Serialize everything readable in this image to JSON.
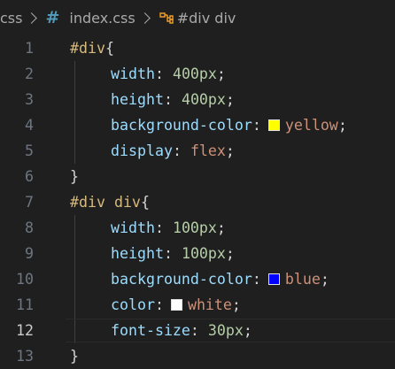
{
  "breadcrumb": {
    "folder": "css",
    "file_icon": "#",
    "file": "index.css",
    "symbol_icon": "symbol-class-icon",
    "symbol": "#div div"
  },
  "lines": [
    {
      "n": "1"
    },
    {
      "n": "2"
    },
    {
      "n": "3"
    },
    {
      "n": "4"
    },
    {
      "n": "5"
    },
    {
      "n": "6"
    },
    {
      "n": "7"
    },
    {
      "n": "8"
    },
    {
      "n": "9"
    },
    {
      "n": "10"
    },
    {
      "n": "11"
    },
    {
      "n": "12"
    },
    {
      "n": "13"
    }
  ],
  "code": {
    "sel1": "#div",
    "open": "{",
    "close": "}",
    "colon": ":",
    "semi": ";",
    "width": "width",
    "height": "height",
    "bg": "background-color",
    "display": "display",
    "color": "color",
    "fontsize": "font-size",
    "v400": "400px",
    "yellow": "yellow",
    "flex": "flex",
    "sel2": "#div div",
    "v100": "100px",
    "blue": "blue",
    "white": "white",
    "v30": "30px"
  },
  "colors": {
    "swatch_yellow": "#ffff00",
    "swatch_blue": "#0000ff",
    "swatch_white": "#ffffff"
  },
  "current_line": "12"
}
